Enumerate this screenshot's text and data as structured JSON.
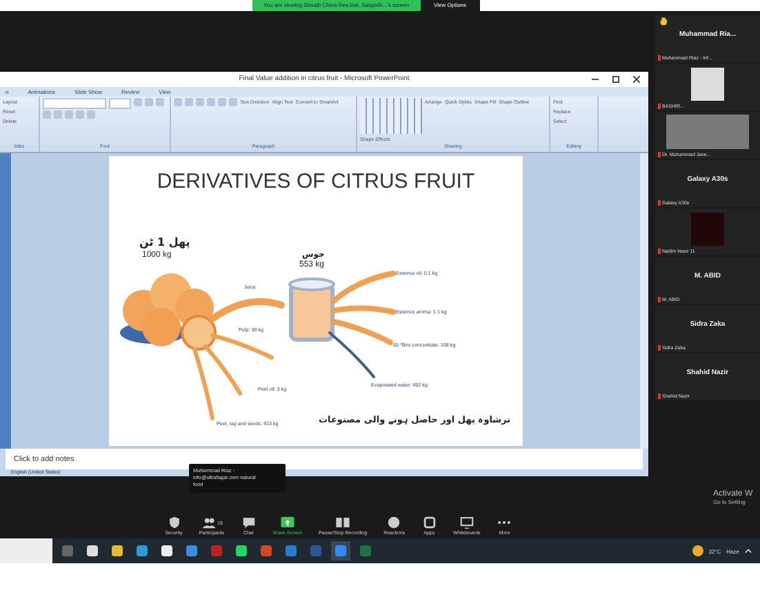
{
  "banner": {
    "text": "You are viewing Shoaib China Res.Inst. Sargodh...'s screen",
    "button": "View Options"
  },
  "powerpoint": {
    "title": "Final Value addition in citrus fruit - Microsoft PowerPoint",
    "tabs": [
      {
        "label": "n",
        "selected": false
      },
      {
        "label": "Animations",
        "selected": false
      },
      {
        "label": "Slide Show",
        "selected": false
      },
      {
        "label": "Review",
        "selected": false
      },
      {
        "label": "View",
        "selected": false
      }
    ],
    "ribbon_groups": [
      {
        "label": "lides",
        "items": [
          "Layout",
          "Reset",
          "Delete"
        ]
      },
      {
        "label": "Font"
      },
      {
        "label": "Paragraph",
        "items": [
          "Text Direction",
          "Align Text",
          "Convert to SmartArt"
        ]
      },
      {
        "label": "Drawing",
        "items": [
          "Arrange",
          "Quick Styles",
          "Shape Fill",
          "Shape Outline",
          "Shape Effects"
        ]
      },
      {
        "label": "Editing",
        "items": [
          "Find",
          "Replace",
          "Select"
        ]
      }
    ],
    "slide": {
      "title": "DERIVATIVES OF CITRUS FRUIT",
      "labels": [
        {
          "kind": "urdu",
          "text": "پھل 1 ٹن"
        },
        {
          "kind": "plain",
          "text": "1000 kg"
        },
        {
          "kind": "urdu",
          "text": "جوس"
        },
        {
          "kind": "plain",
          "text": "553 kg"
        },
        {
          "kind": "small",
          "text": "Juice"
        },
        {
          "kind": "small",
          "text": "Pulp: 30 kg"
        },
        {
          "kind": "small",
          "text": "Peel oil: 3 kg"
        },
        {
          "kind": "small",
          "text": "Peel, rag and seeds: 413 kg"
        },
        {
          "kind": "small",
          "text": "Essence oil: 0.1 kg"
        },
        {
          "kind": "small",
          "text": "Essence aroma: 1.1 kg"
        },
        {
          "kind": "small",
          "text": "65 °Brix concentrate: 108 kg"
        },
        {
          "kind": "small",
          "text": "Evaporated water: 452 kg"
        },
        {
          "kind": "urdu",
          "text": "ترشاوہ پھل اور حاصل ہونے والی مصنوعات"
        }
      ]
    },
    "notes": {
      "placeholder": "Click to add notes"
    },
    "status_bar": "English (United States)"
  },
  "tooltip": [
    "Muhammad Riaz -",
    "info@ultrafagar.com natural",
    "food"
  ],
  "participants": [
    {
      "kind": "name",
      "name": "Muhammad Ria...",
      "label": "Muhammad Riaz - Inf...",
      "hand_raised": true
    },
    {
      "kind": "video",
      "label": "BASHIR..."
    },
    {
      "kind": "wide_video",
      "label": "Dr. Muhammad Jave..."
    },
    {
      "kind": "name",
      "name": "Galaxy A30s",
      "label": "Galaxy A30s",
      "hand_raised": false
    },
    {
      "kind": "dark",
      "label": "Nadim Nasir 11"
    },
    {
      "kind": "name",
      "name": "M. ABID",
      "label": "M. ABID",
      "hand_raised": false
    },
    {
      "kind": "name",
      "name": "Sidra Zaka",
      "label": "Sidra Zaka",
      "hand_raised": false
    },
    {
      "kind": "name",
      "name": "Shahid Nazir",
      "label": "Shahid Nazir",
      "hand_raised": false
    }
  ],
  "activation": [
    "Activate W",
    "Go to Setting"
  ],
  "toolbar": [
    {
      "kind": "security",
      "label": "Security"
    },
    {
      "kind": "participants",
      "label": "Participants",
      "count": "19"
    },
    {
      "kind": "chat",
      "label": "Chat"
    },
    {
      "kind": "share",
      "label": "Share Screen"
    },
    {
      "kind": "record",
      "label": "Pause/Stop Recording"
    },
    {
      "kind": "reactions",
      "label": "Reactions"
    },
    {
      "kind": "apps",
      "label": "Apps"
    },
    {
      "kind": "whiteboard",
      "label": "Whiteboards"
    },
    {
      "kind": "more",
      "label": "More"
    }
  ],
  "taskbar": {
    "temperature": "32°C",
    "weather": "Haze"
  }
}
